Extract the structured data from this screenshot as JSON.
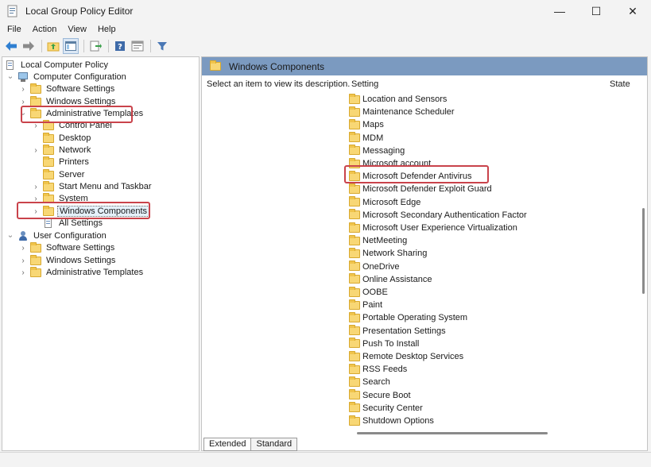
{
  "window": {
    "title": "Local Group Policy Editor",
    "controls": [
      "minimize-icon",
      "maximize-icon",
      "close-icon"
    ]
  },
  "menu": [
    "File",
    "Action",
    "View",
    "Help"
  ],
  "toolbar": [
    "back-icon",
    "forward-icon",
    "up-folder-icon",
    "show-hide-tree-icon",
    "export-list-icon",
    "help-icon",
    "properties-icon",
    "filter-icon"
  ],
  "tree": {
    "root": "Local Computer Policy",
    "computer_config": "Computer Configuration",
    "cc_software": "Software Settings",
    "cc_windows": "Windows Settings",
    "cc_admin": "Administrative Templates",
    "control_panel": "Control Panel",
    "desktop": "Desktop",
    "network": "Network",
    "printers": "Printers",
    "server": "Server",
    "start_menu": "Start Menu and Taskbar",
    "system": "System",
    "windows_components": "Windows Components",
    "all_settings": "All Settings",
    "user_config": "User Configuration",
    "uc_software": "Software Settings",
    "uc_windows": "Windows Settings",
    "uc_admin": "Administrative Templates"
  },
  "right": {
    "header": "Windows Components",
    "description": "Select an item to view its description.",
    "col_setting": "Setting",
    "col_state": "State",
    "items": [
      "Location and Sensors",
      "Maintenance Scheduler",
      "Maps",
      "MDM",
      "Messaging",
      "Microsoft account",
      "Microsoft Defender Antivirus",
      "Microsoft Defender Exploit Guard",
      "Microsoft Edge",
      "Microsoft Secondary Authentication Factor",
      "Microsoft User Experience Virtualization",
      "NetMeeting",
      "Network Sharing",
      "OneDrive",
      "Online Assistance",
      "OOBE",
      "Paint",
      "Portable Operating System",
      "Presentation Settings",
      "Push To Install",
      "Remote Desktop Services",
      "RSS Feeds",
      "Search",
      "Secure Boot",
      "Security Center",
      "Shutdown Options"
    ]
  },
  "tabs": [
    "Extended",
    "Standard"
  ],
  "colors": {
    "header_bg": "#7b9ac0",
    "highlight_box": "#c9434b",
    "folder": "#f8d775"
  }
}
